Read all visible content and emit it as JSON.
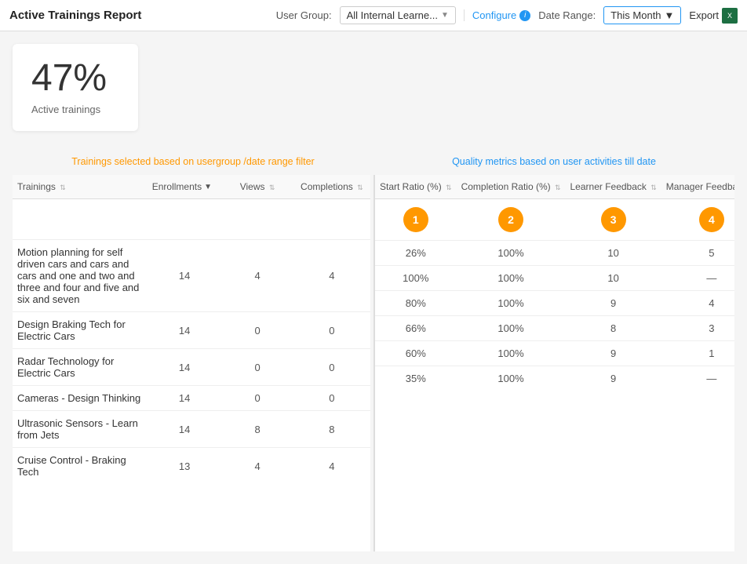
{
  "header": {
    "title": "Active Trainings Report",
    "user_group_label": "User Group:",
    "user_group_value": "All Internal Learne...",
    "configure_label": "Configure",
    "date_range_label": "Date Range:",
    "date_range_value": "This Month",
    "export_label": "Export"
  },
  "stats": {
    "percentage": "47%",
    "label": "Active trainings"
  },
  "banners": {
    "left": "Trainings selected based on usergroup /date range filter",
    "right": "Quality metrics based on user activities till date"
  },
  "table": {
    "left_headers": [
      {
        "label": "Trainings",
        "sort": "updown"
      },
      {
        "label": "Enrollments",
        "sort": "down"
      },
      {
        "label": "Views",
        "sort": "updown"
      },
      {
        "label": "Completions",
        "sort": "updown"
      }
    ],
    "right_headers": [
      {
        "label": "Start Ratio (%)",
        "sort": "updown"
      },
      {
        "label": "Completion Ratio (%)",
        "sort": "updown"
      },
      {
        "label": "Learner Feedback",
        "sort": "updown"
      },
      {
        "label": "Manager Feedback",
        "sort": "updown"
      }
    ],
    "badges": [
      "1",
      "2",
      "3",
      "4"
    ],
    "rows": [
      {
        "training": "Motion planning for self driven cars and cars and cars and one and two and three and four and five and six and seven",
        "enrollments": "14",
        "views": "4",
        "completions": "4",
        "start_ratio": "26%",
        "completion_ratio": "100%",
        "learner_feedback": "10",
        "manager_feedback": "5"
      },
      {
        "training": "Design Braking Tech for Electric Cars",
        "enrollments": "14",
        "views": "0",
        "completions": "0",
        "start_ratio": "100%",
        "completion_ratio": "100%",
        "learner_feedback": "10",
        "manager_feedback": "—"
      },
      {
        "training": "Radar Technology for Electric Cars",
        "enrollments": "14",
        "views": "0",
        "completions": "0",
        "start_ratio": "80%",
        "completion_ratio": "100%",
        "learner_feedback": "9",
        "manager_feedback": "4"
      },
      {
        "training": "Cameras - Design Thinking",
        "enrollments": "14",
        "views": "0",
        "completions": "0",
        "start_ratio": "66%",
        "completion_ratio": "100%",
        "learner_feedback": "8",
        "manager_feedback": "3"
      },
      {
        "training": "Ultrasonic Sensors - Learn from Jets",
        "enrollments": "14",
        "views": "8",
        "completions": "8",
        "start_ratio": "60%",
        "completion_ratio": "100%",
        "learner_feedback": "9",
        "manager_feedback": "1"
      },
      {
        "training": "Cruise Control - Braking Tech",
        "enrollments": "13",
        "views": "4",
        "completions": "4",
        "start_ratio": "35%",
        "completion_ratio": "100%",
        "learner_feedback": "9",
        "manager_feedback": "—"
      }
    ]
  }
}
